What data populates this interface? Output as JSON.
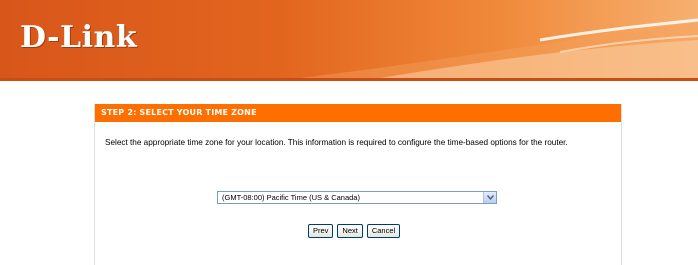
{
  "header": {
    "logo_text": "D-Link"
  },
  "step": {
    "title": "STEP 2: SELECT YOUR TIME ZONE",
    "description": "Select the appropriate time zone for your location. This information is required to configure the time-based options for the router."
  },
  "timezone_select": {
    "selected_value": "(GMT-08:00) Pacific Time (US & Canada)"
  },
  "buttons": {
    "prev": "Prev",
    "next": "Next",
    "cancel": "Cancel"
  },
  "colors": {
    "header_orange": "#e2651e",
    "step_title_bar": "#ff6f00",
    "button_border": "#003c74"
  }
}
